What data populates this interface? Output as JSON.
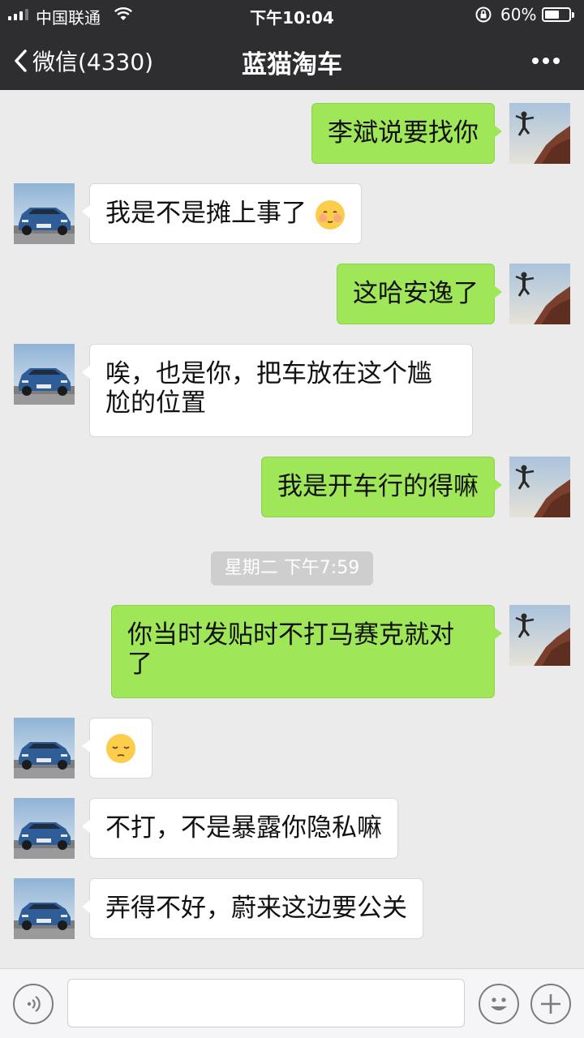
{
  "status_bar": {
    "carrier": "中国联通",
    "time": "下午10:04",
    "battery": "60%",
    "battery_level": 0.6
  },
  "nav": {
    "back_label": "微信(4330)",
    "title": "蓝猫淘车"
  },
  "messages": [
    {
      "from": "me",
      "text": "李斌说要找你"
    },
    {
      "from": "them",
      "text": "我是不是摊上事了",
      "emoji": "flushed-face"
    },
    {
      "from": "me",
      "text": "这哈安逸了"
    },
    {
      "from": "them",
      "line1": "唉，也是你，把车放在这个尴",
      "line2": "尬的位置"
    },
    {
      "from": "me",
      "text": "我是开车行的得嘛"
    },
    {
      "from": "me",
      "line1": "你当时发贴时不打马赛克就对",
      "line2": "了"
    },
    {
      "from": "them",
      "emoji": "pensive-face"
    },
    {
      "from": "them",
      "text": "不打，不是暴露你隐私嘛"
    },
    {
      "from": "them",
      "text": "弄得不好，蔚来这边要公关"
    }
  ],
  "timestamp": "星期二 下午7:59",
  "colors": {
    "header_bg": "#2e2e30",
    "chat_bg": "#ebebeb",
    "my_bubble": "#9fe658",
    "their_bubble": "#ffffff"
  }
}
